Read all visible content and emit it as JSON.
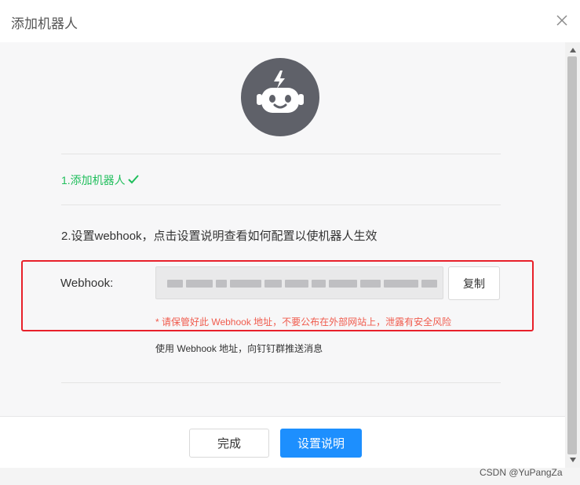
{
  "dialog": {
    "title": "添加机器人"
  },
  "steps": {
    "step1": "1.添加机器人",
    "step2": "2.设置webhook，点击设置说明查看如何配置以使机器人生效"
  },
  "webhook": {
    "label": "Webhook:",
    "copy_label": "复制",
    "warning": "* 请保管好此 Webhook 地址，不要公布在外部网站上，泄露有安全风险",
    "usage": "使用 Webhook 地址，向钉钉群推送消息"
  },
  "footer": {
    "done_label": "完成",
    "help_label": "设置说明"
  },
  "watermark": "CSDN @YuPangZa",
  "icons": {
    "close": "close-icon",
    "robot": "robot-avatar-icon",
    "check": "check-icon"
  },
  "colors": {
    "success": "#1fbe5b",
    "primary": "#1d8ffe",
    "warning": "#f05b4d",
    "highlight_border": "#e8202a"
  }
}
